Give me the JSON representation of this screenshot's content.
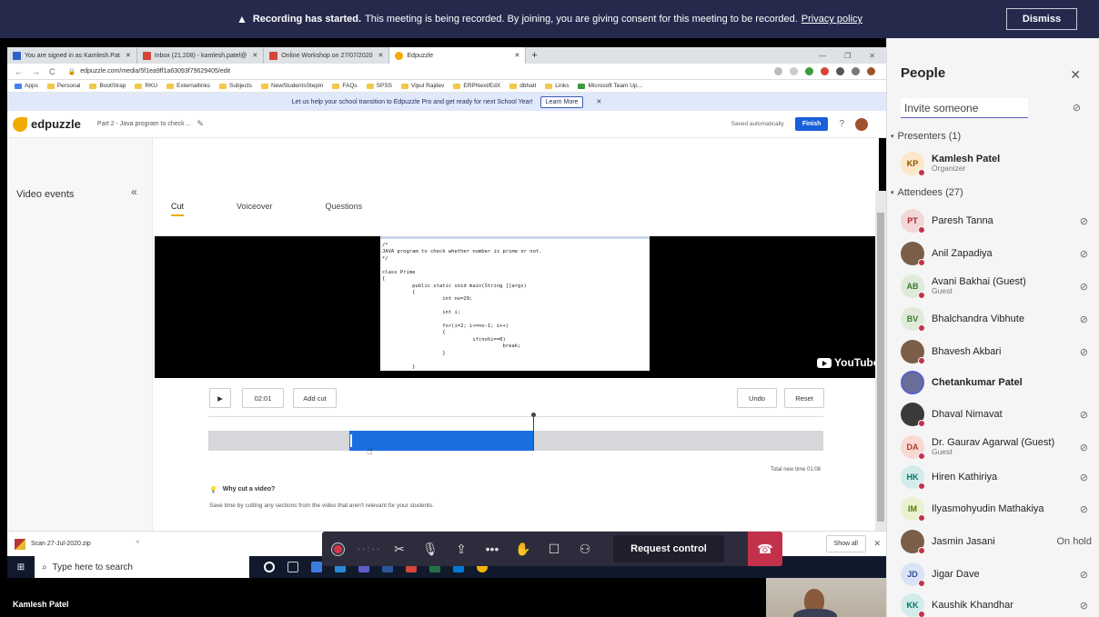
{
  "banner": {
    "bold": "Recording has started.",
    "text": "This meeting is being recorded. By joining, you are giving consent for this meeting to be recorded.",
    "link": "Privacy policy",
    "dismiss": "Dismiss"
  },
  "browser": {
    "tabs": [
      {
        "label": "You are signed in as Kamlesh.Pat",
        "color": "#2b62c9"
      },
      {
        "label": "Inbox (21,208) - kamlesh.patel@",
        "color": "#d44638"
      },
      {
        "label": "Online Workshop on 27/07/2020",
        "color": "#d44638"
      },
      {
        "label": "Edpuzzle",
        "color": "#f2a900"
      }
    ],
    "url": "edpuzzle.com/media/5f1ea9ff1a63093f79629405/edit",
    "bookmarks": [
      "Apps",
      "Personal",
      "BootStrap",
      "RKU",
      "Externallinks",
      "Subjects",
      "NewStudentsStepIn",
      "FAQs",
      "SPSS",
      "Vipul Rajdev",
      "ERPNext/EdX",
      "dbhatt",
      "Links",
      "Microsoft Team Up..."
    ]
  },
  "promo": {
    "text": "Let us help your school transition to Edpuzzle Pro and get ready for next School Year!",
    "button": "Learn More"
  },
  "edpuzzle": {
    "logo": "edpuzzle",
    "title": "Part 2 - Java program to check ...",
    "saved": "Saved automatically",
    "finish": "Finish",
    "video_events": "Video events",
    "tabs": [
      "Cut",
      "Voiceover",
      "Questions"
    ],
    "code": "/*\nJAVA program to check whether number is prime or not.\n*/\n\nclass Prime\n{\n          public static void main(String []args)\n          {\n                    int no=29;\n\n                    int i;\n\n                    for(i=2; i<=no-1; i++)\n                    {\n                              if(no%i==0)\n                                        break;\n                    }\n\n          }\n}",
    "youtube": "YouTube",
    "time": "02:01",
    "add_cut": "Add cut",
    "undo": "Undo",
    "reset": "Reset",
    "total_time": "Total new time 01:08",
    "why_title": "Why cut a video?",
    "why_desc": "Save time by cutting any sections from the video that aren't relevant for your students."
  },
  "downloads": {
    "file": "Scan 27-Jul-2020.zip",
    "show_all": "Show all"
  },
  "taskbar": {
    "search_placeholder": "Type here to search"
  },
  "meeting": {
    "request_control": "Request control",
    "presenter_name": "Kamlesh Patel"
  },
  "people": {
    "title": "People",
    "invite_placeholder": "Invite someone",
    "presenters_label": "Presenters (1)",
    "attendees_label": "Attendees (27)",
    "presenters": [
      {
        "initials": "KP",
        "name": "Kamlesh Patel",
        "role": "Organizer",
        "bg": "#fde7c8",
        "fg": "#8a5300"
      }
    ],
    "attendees": [
      {
        "initials": "PT",
        "name": "Paresh Tanna",
        "role": "",
        "bg": "#f3d6d8",
        "fg": "#a4262c",
        "status": ""
      },
      {
        "initials": "",
        "name": "Anil Zapadiya",
        "role": "",
        "bg": "#7a5e48",
        "fg": "#fff",
        "status": ""
      },
      {
        "initials": "AB",
        "name": "Avani Bakhai (Guest)",
        "role": "Guest",
        "bg": "#dfeadb",
        "fg": "#3a7a2a",
        "status": ""
      },
      {
        "initials": "BV",
        "name": "Bhalchandra Vibhute",
        "role": "",
        "bg": "#dfeadb",
        "fg": "#3a7a2a",
        "status": ""
      },
      {
        "initials": "",
        "name": "Bhavesh Akbari",
        "role": "",
        "bg": "#7a5e48",
        "fg": "#fff",
        "status": ""
      },
      {
        "initials": "",
        "name": "Chetankumar Patel",
        "role": "",
        "bg": "#6a6f9a",
        "fg": "#fff",
        "status": ""
      },
      {
        "initials": "",
        "name": "Dhaval Nimavat",
        "role": "",
        "bg": "#3a3a3a",
        "fg": "#fff",
        "status": ""
      },
      {
        "initials": "DA",
        "name": "Dr. Gaurav Agarwal (Guest)",
        "role": "Guest",
        "bg": "#f9d9d2",
        "fg": "#b23b22",
        "status": ""
      },
      {
        "initials": "HK",
        "name": "Hiren Kathiriya",
        "role": "",
        "bg": "#d2ecea",
        "fg": "#00756b",
        "status": ""
      },
      {
        "initials": "IM",
        "name": "Ilyasmohyudin Mathakiya",
        "role": "",
        "bg": "#e8f2cf",
        "fg": "#5d7a00",
        "status": ""
      },
      {
        "initials": "",
        "name": "Jasmin Jasani",
        "role": "",
        "bg": "#7a5e48",
        "fg": "#fff",
        "status": "On hold"
      },
      {
        "initials": "JD",
        "name": "Jigar Dave",
        "role": "",
        "bg": "#dbe3f6",
        "fg": "#2f4a9a",
        "status": ""
      },
      {
        "initials": "KK",
        "name": "Kaushik Khandhar",
        "role": "",
        "bg": "#d2ecea",
        "fg": "#00756b",
        "status": ""
      }
    ]
  }
}
